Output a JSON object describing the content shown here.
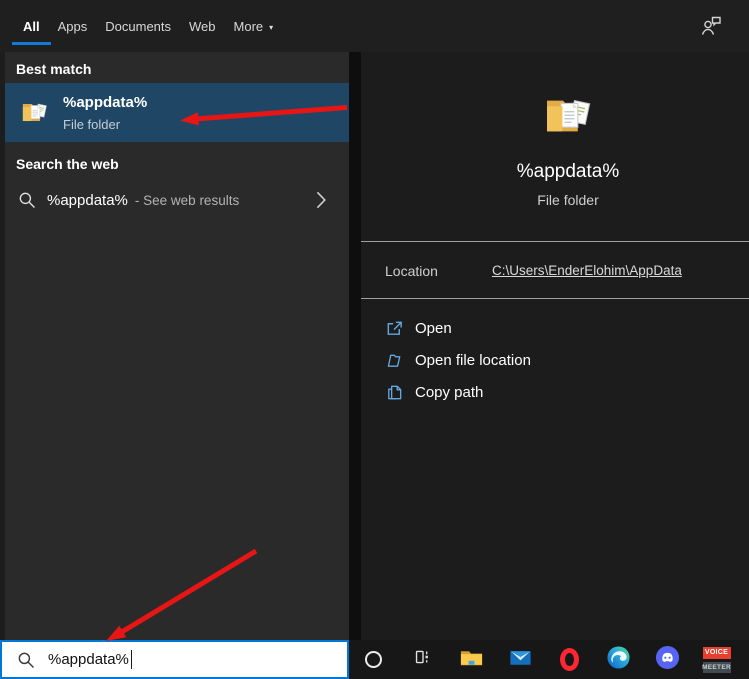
{
  "topbar": {
    "tabs": [
      {
        "label": "All",
        "active": true
      },
      {
        "label": "Apps",
        "active": false
      },
      {
        "label": "Documents",
        "active": false
      },
      {
        "label": "Web",
        "active": false
      },
      {
        "label": "More",
        "active": false,
        "caret": true
      }
    ]
  },
  "icons": {
    "caret_down": "▾"
  },
  "left_panel": {
    "best_match_header": "Best match",
    "best_match": {
      "title": "%appdata%",
      "subtitle": "File folder"
    },
    "search_web_header": "Search the web",
    "web_result": {
      "query": "%appdata%",
      "suffix": "- See web results"
    }
  },
  "right_panel": {
    "title": "%appdata%",
    "subtitle": "File folder",
    "location_label": "Location",
    "location_path": "C:\\Users\\EnderElohim\\AppData",
    "actions": [
      {
        "label": "Open"
      },
      {
        "label": "Open file location"
      },
      {
        "label": "Copy path"
      }
    ]
  },
  "search_box": {
    "value": "%appdata%"
  },
  "taskbar": {
    "voicemeeter": {
      "top": "VOICE",
      "bottom": "MEETER"
    }
  },
  "colors": {
    "accent_blue": "#0f7bd7",
    "best_match_highlight": "#1f4765",
    "action_icon_blue": "#64a8e0",
    "arrow_red": "#e81515",
    "search_border": "#0078d7",
    "discord_purple": "#5865f2",
    "opera_red": "#ff2634"
  }
}
